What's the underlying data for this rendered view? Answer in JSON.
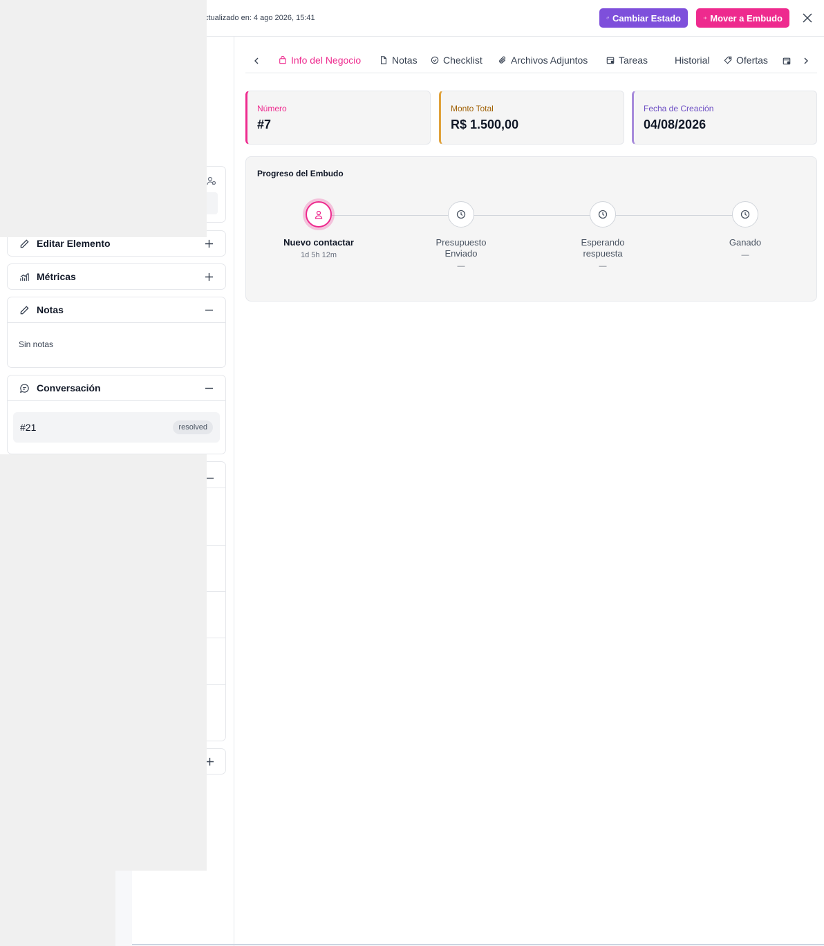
{
  "header": {
    "updated_text": "ctualizado en: 4 ago 2026, 15:41",
    "change_state_label": "Cambiar Estado",
    "move_funnel_label": "Mover a Embudo"
  },
  "colors": {
    "accent_pink": "#ee2a8e",
    "accent_purple": "#7e4fdb",
    "card_number": "#ee2a8e",
    "card_amount": "#e0a23b",
    "card_date": "#a78bdb"
  },
  "sidebar": {
    "edit_item_label": "Editar Elemento",
    "metrics_label": "Métricas",
    "notes_label": "Notas",
    "notes_empty": "Sin notas",
    "conversation_label": "Conversación",
    "conversation": {
      "number": "#21",
      "status": "resolved"
    }
  },
  "tabs": [
    {
      "label": "Info del Negocio",
      "icon": "bag-icon",
      "active": true
    },
    {
      "label": "Notas",
      "icon": "file-icon",
      "active": false
    },
    {
      "label": "Checklist",
      "icon": "check-circle-icon",
      "active": false
    },
    {
      "label": "Archivos Adjuntos",
      "icon": "paperclip-icon",
      "active": false
    },
    {
      "label": "Tareas",
      "icon": "calendar-icon",
      "active": false
    },
    {
      "label": "Historial",
      "icon": "",
      "active": false
    },
    {
      "label": "Ofertas",
      "icon": "tag-icon",
      "active": false
    }
  ],
  "cards": {
    "number": {
      "label": "Número",
      "value": "#7"
    },
    "amount": {
      "label": "Monto Total",
      "value": "R$ 1.500,00"
    },
    "date": {
      "label": "Fecha de Creación",
      "value": "04/08/2026"
    }
  },
  "progress": {
    "title": "Progreso del Embudo",
    "steps": [
      {
        "name": "Nuevo contactar",
        "meta": "1d 5h 12m",
        "active": true
      },
      {
        "name": "Presupuesto Enviado",
        "meta": "—",
        "active": false
      },
      {
        "name": "Esperando respuesta",
        "meta": "—",
        "active": false
      },
      {
        "name": "Ganado",
        "meta": "—",
        "active": false
      }
    ]
  }
}
